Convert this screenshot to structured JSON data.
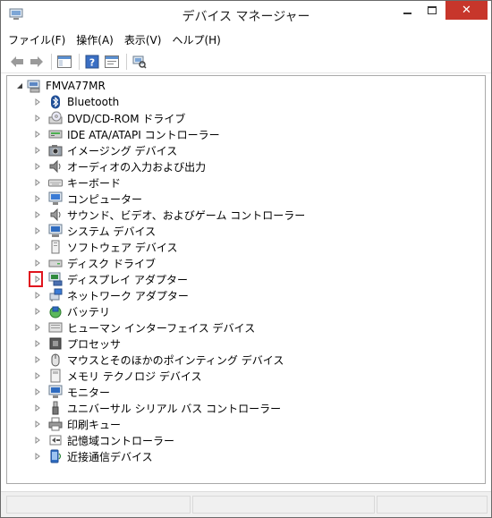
{
  "window": {
    "title": "デバイス マネージャー"
  },
  "menu": [
    {
      "label": "ファイル(F)"
    },
    {
      "label": "操作(A)"
    },
    {
      "label": "表示(V)"
    },
    {
      "label": "ヘルプ(H)"
    }
  ],
  "colors": {
    "highlight": "#e0141e",
    "close_button": "#c7362b"
  },
  "tree": {
    "root": {
      "label": "FMVA77MR",
      "icon": "computer-icon",
      "expanded": true
    },
    "items": [
      {
        "label": "Bluetooth",
        "icon": "bluetooth-icon"
      },
      {
        "label": "DVD/CD-ROM ドライブ",
        "icon": "dvd-drive-icon"
      },
      {
        "label": "IDE ATA/ATAPI コントローラー",
        "icon": "ide-controller-icon"
      },
      {
        "label": "イメージング デバイス",
        "icon": "imaging-device-icon"
      },
      {
        "label": "オーディオの入力および出力",
        "icon": "audio-io-icon"
      },
      {
        "label": "キーボード",
        "icon": "keyboard-icon"
      },
      {
        "label": "コンピューター",
        "icon": "computer-monitor-icon"
      },
      {
        "label": "サウンド、ビデオ、およびゲーム コントローラー",
        "icon": "sound-icon"
      },
      {
        "label": "システム デバイス",
        "icon": "system-device-icon"
      },
      {
        "label": "ソフトウェア デバイス",
        "icon": "software-device-icon"
      },
      {
        "label": "ディスク ドライブ",
        "icon": "disk-drive-icon"
      },
      {
        "label": "ディスプレイ アダプター",
        "icon": "display-adapter-icon",
        "highlighted": true
      },
      {
        "label": "ネットワーク アダプター",
        "icon": "network-adapter-icon"
      },
      {
        "label": "バッテリ",
        "icon": "battery-icon"
      },
      {
        "label": "ヒューマン インターフェイス デバイス",
        "icon": "hid-icon"
      },
      {
        "label": "プロセッサ",
        "icon": "processor-icon"
      },
      {
        "label": "マウスとそのほかのポインティング デバイス",
        "icon": "mouse-icon"
      },
      {
        "label": "メモリ テクノロジ デバイス",
        "icon": "memory-device-icon"
      },
      {
        "label": "モニター",
        "icon": "monitor-icon"
      },
      {
        "label": "ユニバーサル シリアル バス コントローラー",
        "icon": "usb-icon"
      },
      {
        "label": "印刷キュー",
        "icon": "printer-icon"
      },
      {
        "label": "記憶域コントローラー",
        "icon": "storage-controller-icon"
      },
      {
        "label": "近接通信デバイス",
        "icon": "proximity-device-icon"
      }
    ]
  }
}
